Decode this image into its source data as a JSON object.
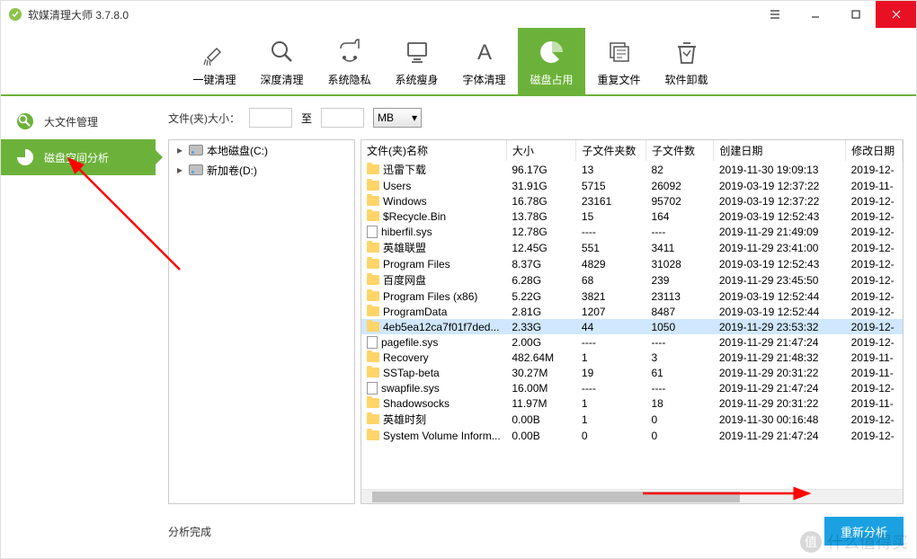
{
  "window": {
    "title": "软媒清理大师 3.7.8.0"
  },
  "toolbar": {
    "items": [
      {
        "label": "一键清理",
        "name": "one-click-clean"
      },
      {
        "label": "深度清理",
        "name": "deep-clean"
      },
      {
        "label": "系统隐私",
        "name": "system-privacy"
      },
      {
        "label": "系统瘦身",
        "name": "system-slim"
      },
      {
        "label": "字体清理",
        "name": "font-clean"
      },
      {
        "label": "磁盘占用",
        "name": "disk-usage",
        "active": true
      },
      {
        "label": "重复文件",
        "name": "dup-files"
      },
      {
        "label": "软件卸载",
        "name": "uninstall"
      }
    ]
  },
  "sidebar": {
    "items": [
      {
        "label": "大文件管理",
        "name": "large-file"
      },
      {
        "label": "磁盘空间分析",
        "name": "disk-space",
        "active": true
      }
    ]
  },
  "filter": {
    "label": "文件(夹)大小：",
    "to": "至",
    "unit": "MB"
  },
  "tree": {
    "drives": [
      {
        "label": "本地磁盘(C:)",
        "name": "drive-c"
      },
      {
        "label": "新加卷(D:)",
        "name": "drive-d"
      }
    ]
  },
  "table": {
    "columns": [
      "文件(夹)名称",
      "大小",
      "子文件夹数",
      "子文件数",
      "创建日期",
      "修改日期"
    ],
    "rows": [
      {
        "name": "迅雷下载",
        "type": "folder",
        "size": "96.17G",
        "folders": "13",
        "files": "82",
        "created": "2019-11-30 19:09:13",
        "modified": "2019-12-"
      },
      {
        "name": "Users",
        "type": "folder",
        "size": "31.91G",
        "folders": "5715",
        "files": "26092",
        "created": "2019-03-19 12:37:22",
        "modified": "2019-11-"
      },
      {
        "name": "Windows",
        "type": "folder",
        "size": "16.78G",
        "folders": "23161",
        "files": "95702",
        "created": "2019-03-19 12:37:22",
        "modified": "2019-12-"
      },
      {
        "name": "$Recycle.Bin",
        "type": "folder",
        "size": "13.78G",
        "folders": "15",
        "files": "164",
        "created": "2019-03-19 12:52:43",
        "modified": "2019-12-"
      },
      {
        "name": "hiberfil.sys",
        "type": "file",
        "size": "12.78G",
        "folders": "----",
        "files": "----",
        "created": "2019-11-29 21:49:09",
        "modified": "2019-12-"
      },
      {
        "name": "英雄联盟",
        "type": "folder",
        "size": "12.45G",
        "folders": "551",
        "files": "3411",
        "created": "2019-11-29 23:41:00",
        "modified": "2019-12-"
      },
      {
        "name": "Program Files",
        "type": "folder",
        "size": "8.37G",
        "folders": "4829",
        "files": "31028",
        "created": "2019-03-19 12:52:43",
        "modified": "2019-12-"
      },
      {
        "name": "百度网盘",
        "type": "folder",
        "size": "6.28G",
        "folders": "68",
        "files": "239",
        "created": "2019-11-29 23:45:50",
        "modified": "2019-12-"
      },
      {
        "name": "Program Files (x86)",
        "type": "folder",
        "size": "5.22G",
        "folders": "3821",
        "files": "23113",
        "created": "2019-03-19 12:52:44",
        "modified": "2019-12-"
      },
      {
        "name": "ProgramData",
        "type": "folder",
        "size": "2.81G",
        "folders": "1207",
        "files": "8487",
        "created": "2019-03-19 12:52:44",
        "modified": "2019-12-"
      },
      {
        "name": "4eb5ea12ca7f01f7ded...",
        "type": "folder",
        "size": "2.33G",
        "folders": "44",
        "files": "1050",
        "created": "2019-11-29 23:53:32",
        "modified": "2019-12-",
        "selected": true
      },
      {
        "name": "pagefile.sys",
        "type": "file",
        "size": "2.00G",
        "folders": "----",
        "files": "----",
        "created": "2019-11-29 21:47:24",
        "modified": "2019-12-"
      },
      {
        "name": "Recovery",
        "type": "folder",
        "size": "482.64M",
        "folders": "1",
        "files": "3",
        "created": "2019-11-29 21:48:32",
        "modified": "2019-11-"
      },
      {
        "name": "SSTap-beta",
        "type": "folder",
        "size": "30.27M",
        "folders": "19",
        "files": "61",
        "created": "2019-11-29 20:31:22",
        "modified": "2019-11-"
      },
      {
        "name": "swapfile.sys",
        "type": "file",
        "size": "16.00M",
        "folders": "----",
        "files": "----",
        "created": "2019-11-29 21:47:24",
        "modified": "2019-12-"
      },
      {
        "name": "Shadowsocks",
        "type": "folder",
        "size": "11.97M",
        "folders": "1",
        "files": "18",
        "created": "2019-11-29 20:31:22",
        "modified": "2019-11-"
      },
      {
        "name": "英雄时刻",
        "type": "folder",
        "size": "0.00B",
        "folders": "1",
        "files": "0",
        "created": "2019-11-30 00:16:48",
        "modified": "2019-12-"
      },
      {
        "name": "System Volume Inform...",
        "type": "folder",
        "size": "0.00B",
        "folders": "0",
        "files": "0",
        "created": "2019-11-29 21:47:24",
        "modified": "2019-12-"
      }
    ]
  },
  "status": {
    "text": "分析完成",
    "button": "重新分析"
  },
  "watermark": "什么值得买"
}
